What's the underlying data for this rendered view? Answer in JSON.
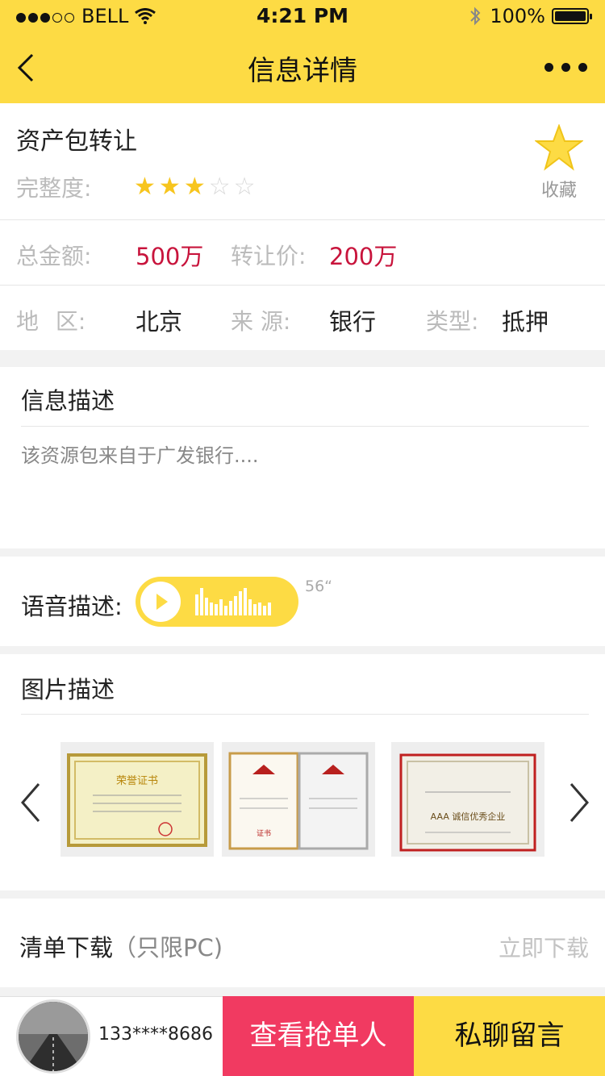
{
  "status_bar": {
    "carrier": "BELL",
    "time": "4:21 PM",
    "battery": "100%"
  },
  "nav": {
    "title": "信息详情"
  },
  "package": {
    "title": "资产包转让",
    "completeness_label": "完整度:",
    "rating": 3,
    "rating_max": 5,
    "favorite_label": "收藏"
  },
  "amounts": {
    "total_label": "总金额:",
    "total_value": "500万",
    "transfer_label": "转让价:",
    "transfer_value": "200万"
  },
  "meta": {
    "region_label": "地  区:",
    "region_value": "北京",
    "source_label": "来  源:",
    "source_value": "银行",
    "type_label": "类型:",
    "type_value": "抵押"
  },
  "description": {
    "title": "信息描述",
    "text": "该资源包来自于广发银行...."
  },
  "voice": {
    "label": "语音描述:",
    "duration": "56“"
  },
  "images": {
    "title": "图片描述",
    "items": [
      "荣誉证书",
      "证书",
      "AAA 诚信优秀企业"
    ]
  },
  "download": {
    "label": "清单下载",
    "note": "（只限PC)",
    "action": "立即下载"
  },
  "bottom": {
    "phone": "133****8686",
    "grab_button": "查看抢单人",
    "chat_button": "私聊留言"
  },
  "colors": {
    "accent": "#fddb44",
    "price": "#c8143c",
    "grab": "#f13a61"
  }
}
